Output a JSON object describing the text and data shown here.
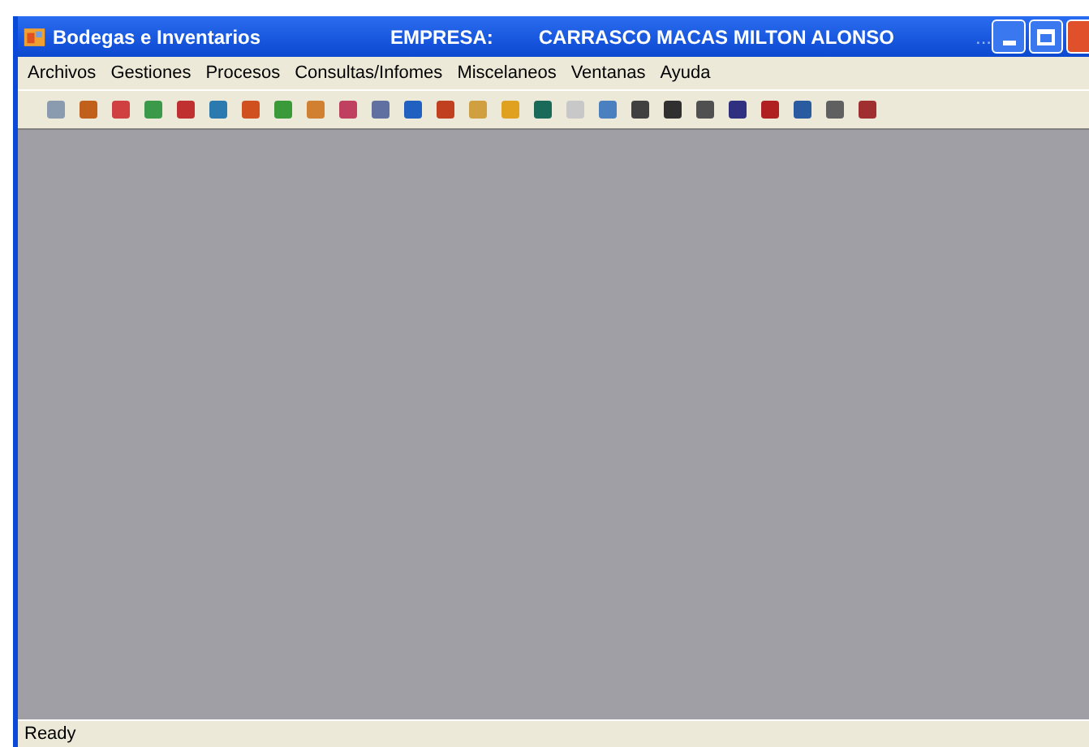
{
  "window": {
    "title": "Bodegas e Inventarios",
    "company_label": "EMPRESA:",
    "company_name": "CARRASCO MACAS MILTON ALONSO",
    "overflow": "..."
  },
  "menu": [
    "Archivos",
    "Gestiones",
    "Procesos",
    "Consultas/Infomes",
    "Miscelaneos",
    "Ventanas",
    "Ayuda"
  ],
  "status_bar": {
    "text": "Ready"
  }
}
